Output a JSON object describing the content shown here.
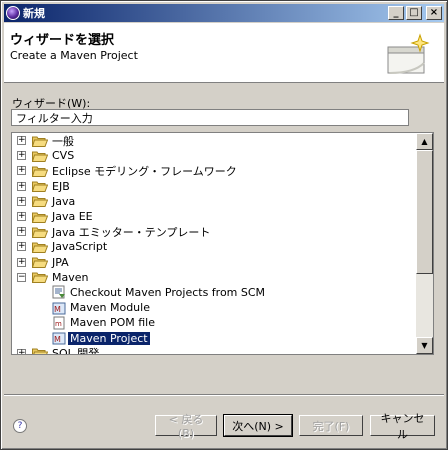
{
  "window": {
    "title": "新規"
  },
  "banner": {
    "title": "ウィザードを選択",
    "subtitle": "Create a Maven Project"
  },
  "filter": {
    "label": "ウィザード(W):",
    "value": "フィルター入力"
  },
  "tree": {
    "items": [
      {
        "label": "一般",
        "expanded": false
      },
      {
        "label": "CVS",
        "expanded": false
      },
      {
        "label": "Eclipse モデリング・フレームワーク",
        "expanded": false
      },
      {
        "label": "EJB",
        "expanded": false
      },
      {
        "label": "Java",
        "expanded": false
      },
      {
        "label": "Java EE",
        "expanded": false
      },
      {
        "label": "Java エミッター・テンプレート",
        "expanded": false
      },
      {
        "label": "JavaScript",
        "expanded": false
      },
      {
        "label": "JPA",
        "expanded": false
      },
      {
        "label": "Maven",
        "expanded": true
      },
      {
        "label": "Checkout Maven Projects from SCM",
        "child": true,
        "icon": "checkout-icon"
      },
      {
        "label": "Maven Module",
        "child": true,
        "icon": "maven-module-icon"
      },
      {
        "label": "Maven POM file",
        "child": true,
        "icon": "pom-file-icon"
      },
      {
        "label": "Maven Project",
        "child": true,
        "icon": "maven-project-icon",
        "selected": true
      },
      {
        "label": "SQL 開発",
        "expanded": false
      }
    ]
  },
  "buttons": {
    "back": "< 戻る(B)",
    "next": "次へ(N) >",
    "finish": "完了(F)",
    "cancel": "キャンセル"
  },
  "help": "?"
}
